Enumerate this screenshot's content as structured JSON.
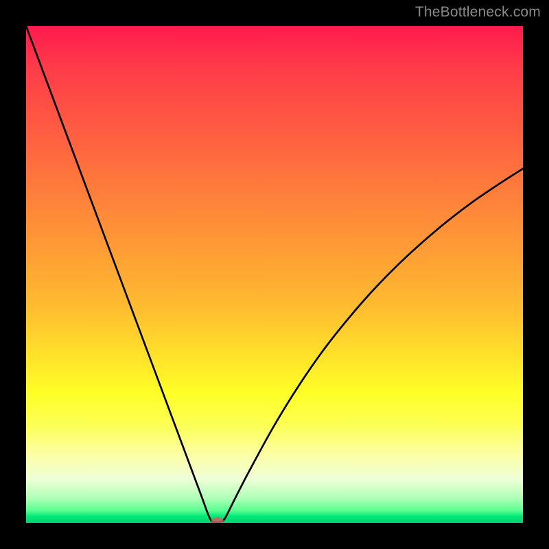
{
  "watermark": "TheBottleneck.com",
  "chart_data": {
    "type": "line",
    "title": "",
    "xlabel": "",
    "ylabel": "",
    "xlim": [
      0,
      100
    ],
    "ylim": [
      0,
      100
    ],
    "grid": false,
    "legend": false,
    "series": [
      {
        "name": "bottleneck-curve",
        "x": [
          0,
          5,
          10,
          15,
          20,
          25,
          30,
          35,
          37,
          38,
          39,
          40,
          42,
          45,
          50,
          55,
          60,
          65,
          70,
          75,
          80,
          85,
          90,
          95,
          100
        ],
        "y": [
          100,
          86.6,
          73.2,
          59.8,
          46.4,
          33.0,
          19.6,
          6.2,
          0.9,
          0.2,
          0.2,
          0.9,
          4.8,
          10.6,
          19.7,
          27.8,
          35.0,
          41.3,
          47.0,
          52.1,
          56.7,
          60.9,
          64.7,
          68.1,
          71.3
        ]
      }
    ],
    "marker": {
      "x": 38.5,
      "y": 0.4
    },
    "gradient_scale": {
      "description": "vertical color gradient; top = worst (red), bottom = best (green)",
      "stops": [
        {
          "pct": 0,
          "color": "#ff1a4d"
        },
        {
          "pct": 50,
          "color": "#ffba30"
        },
        {
          "pct": 78,
          "color": "#ffff28"
        },
        {
          "pct": 100,
          "color": "#00d070"
        }
      ]
    }
  }
}
